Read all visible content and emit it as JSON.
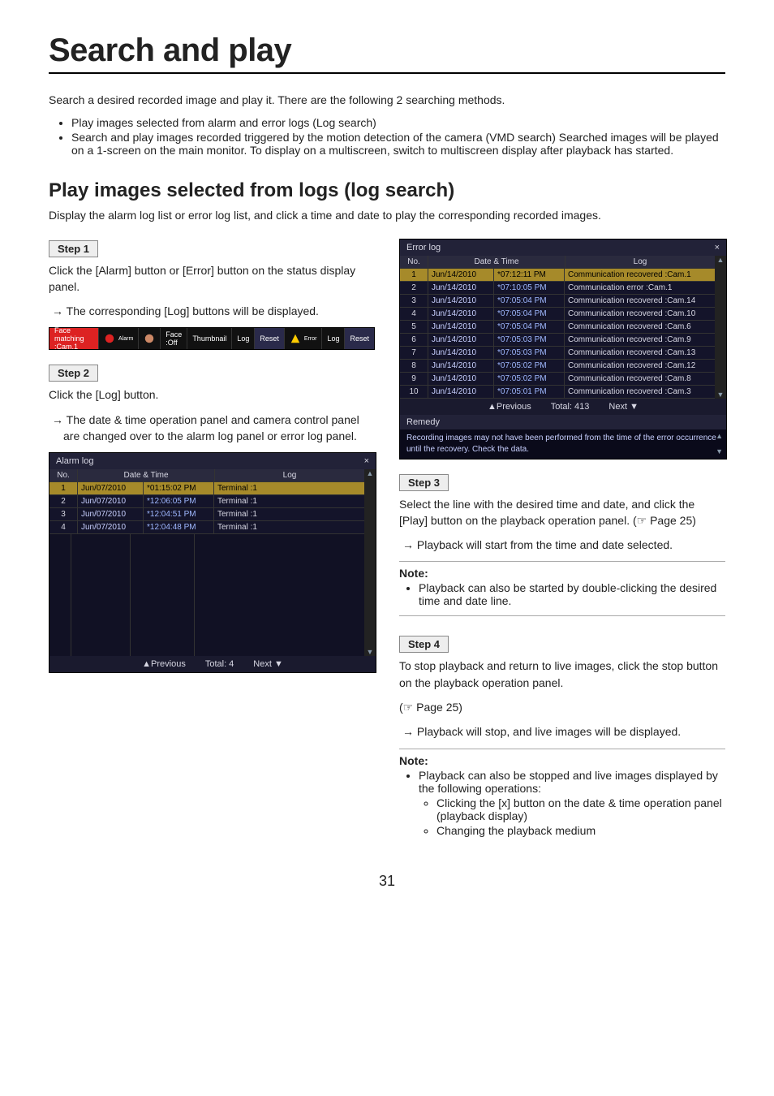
{
  "page_number": "31",
  "title": "Search and play",
  "intro": "Search a desired recorded image and play it. There are the following 2 searching methods.",
  "intro_bullets": [
    "Play images selected from alarm and error logs (Log search)",
    "Search and play images recorded triggered by the motion detection of the camera (VMD search) Searched images will be played on a 1-screen on the main monitor. To display on a multiscreen, switch to multiscreen display after playback has started."
  ],
  "section_title": "Play images selected from logs (log search)",
  "section_intro": "Display the alarm log list or error log list, and click a time and date to play the corresponding recorded images.",
  "step1": {
    "label": "Step 1",
    "text": "Click the [Alarm] button or [Error] button on the status display panel.",
    "arrow": "The corresponding [Log] buttons will be displayed."
  },
  "status_panel": {
    "face": "Face matching :Cam.1",
    "alarm_label": "Alarm",
    "face_off": "Face :Off",
    "thumbnail": "Thumbnail",
    "log": "Log",
    "reset": "Reset",
    "error_label": "Error"
  },
  "step2": {
    "label": "Step 2",
    "text": "Click the [Log] button.",
    "arrow": "The date & time operation panel and camera control panel are changed over to the alarm log panel or error log panel."
  },
  "alarm_log": {
    "title": "Alarm log",
    "head_no": "No.",
    "head_dt": "Date & Time",
    "head_log": "Log",
    "rows": [
      {
        "no": "1",
        "date": "Jun/07/2010",
        "time": "*01:15:02 PM",
        "log": "Terminal :1",
        "sel": true
      },
      {
        "no": "2",
        "date": "Jun/07/2010",
        "time": "*12:06:05 PM",
        "log": "Terminal :1"
      },
      {
        "no": "3",
        "date": "Jun/07/2010",
        "time": "*12:04:51 PM",
        "log": "Terminal :1"
      },
      {
        "no": "4",
        "date": "Jun/07/2010",
        "time": "*12:04:48 PM",
        "log": "Terminal :1"
      }
    ],
    "prev": "▲Previous",
    "total": "Total: 4",
    "next": "Next  ▼"
  },
  "error_log": {
    "title": "Error log",
    "head_no": "No.",
    "head_dt": "Date & Time",
    "head_log": "Log",
    "rows": [
      {
        "no": "1",
        "date": "Jun/14/2010",
        "time": "*07:12:11 PM",
        "log": "Communication recovered :Cam.1",
        "sel": true
      },
      {
        "no": "2",
        "date": "Jun/14/2010",
        "time": "*07:10:05 PM",
        "log": "Communication error :Cam.1"
      },
      {
        "no": "3",
        "date": "Jun/14/2010",
        "time": "*07:05:04 PM",
        "log": "Communication recovered :Cam.14"
      },
      {
        "no": "4",
        "date": "Jun/14/2010",
        "time": "*07:05:04 PM",
        "log": "Communication recovered :Cam.10"
      },
      {
        "no": "5",
        "date": "Jun/14/2010",
        "time": "*07:05:04 PM",
        "log": "Communication recovered :Cam.6"
      },
      {
        "no": "6",
        "date": "Jun/14/2010",
        "time": "*07:05:03 PM",
        "log": "Communication recovered :Cam.9"
      },
      {
        "no": "7",
        "date": "Jun/14/2010",
        "time": "*07:05:03 PM",
        "log": "Communication recovered :Cam.13"
      },
      {
        "no": "8",
        "date": "Jun/14/2010",
        "time": "*07:05:02 PM",
        "log": "Communication recovered :Cam.12"
      },
      {
        "no": "9",
        "date": "Jun/14/2010",
        "time": "*07:05:02 PM",
        "log": "Communication recovered :Cam.8"
      },
      {
        "no": "10",
        "date": "Jun/14/2010",
        "time": "*07:05:01 PM",
        "log": "Communication recovered :Cam.3"
      }
    ],
    "prev": "▲Previous",
    "total": "Total: 413",
    "next": "Next  ▼",
    "remedy_title": "Remedy",
    "remedy_text": "Recording images may not have been performed from the time of the error occurrence until the recovery. Check the data."
  },
  "step3": {
    "label": "Step 3",
    "text": "Select the line with the desired time and date, and click the [Play] button on the playback operation panel. (☞ Page 25)",
    "arrow": "Playback will start from the time and date selected."
  },
  "note3": {
    "title": "Note:",
    "items": [
      "Playback can also be started by double-clicking the desired time and date line."
    ]
  },
  "step4": {
    "label": "Step 4",
    "text1": "To stop playback and return to live images, click the stop button on the playback operation panel.",
    "text2": "(☞ Page 25)",
    "arrow": "Playback will stop, and live images will be displayed."
  },
  "note4": {
    "title": "Note:",
    "lead": "Playback can also be stopped and live images displayed by the following operations:",
    "subs": [
      "Clicking the [x] button on the date & time operation panel (playback display)",
      "Changing the playback medium"
    ]
  }
}
